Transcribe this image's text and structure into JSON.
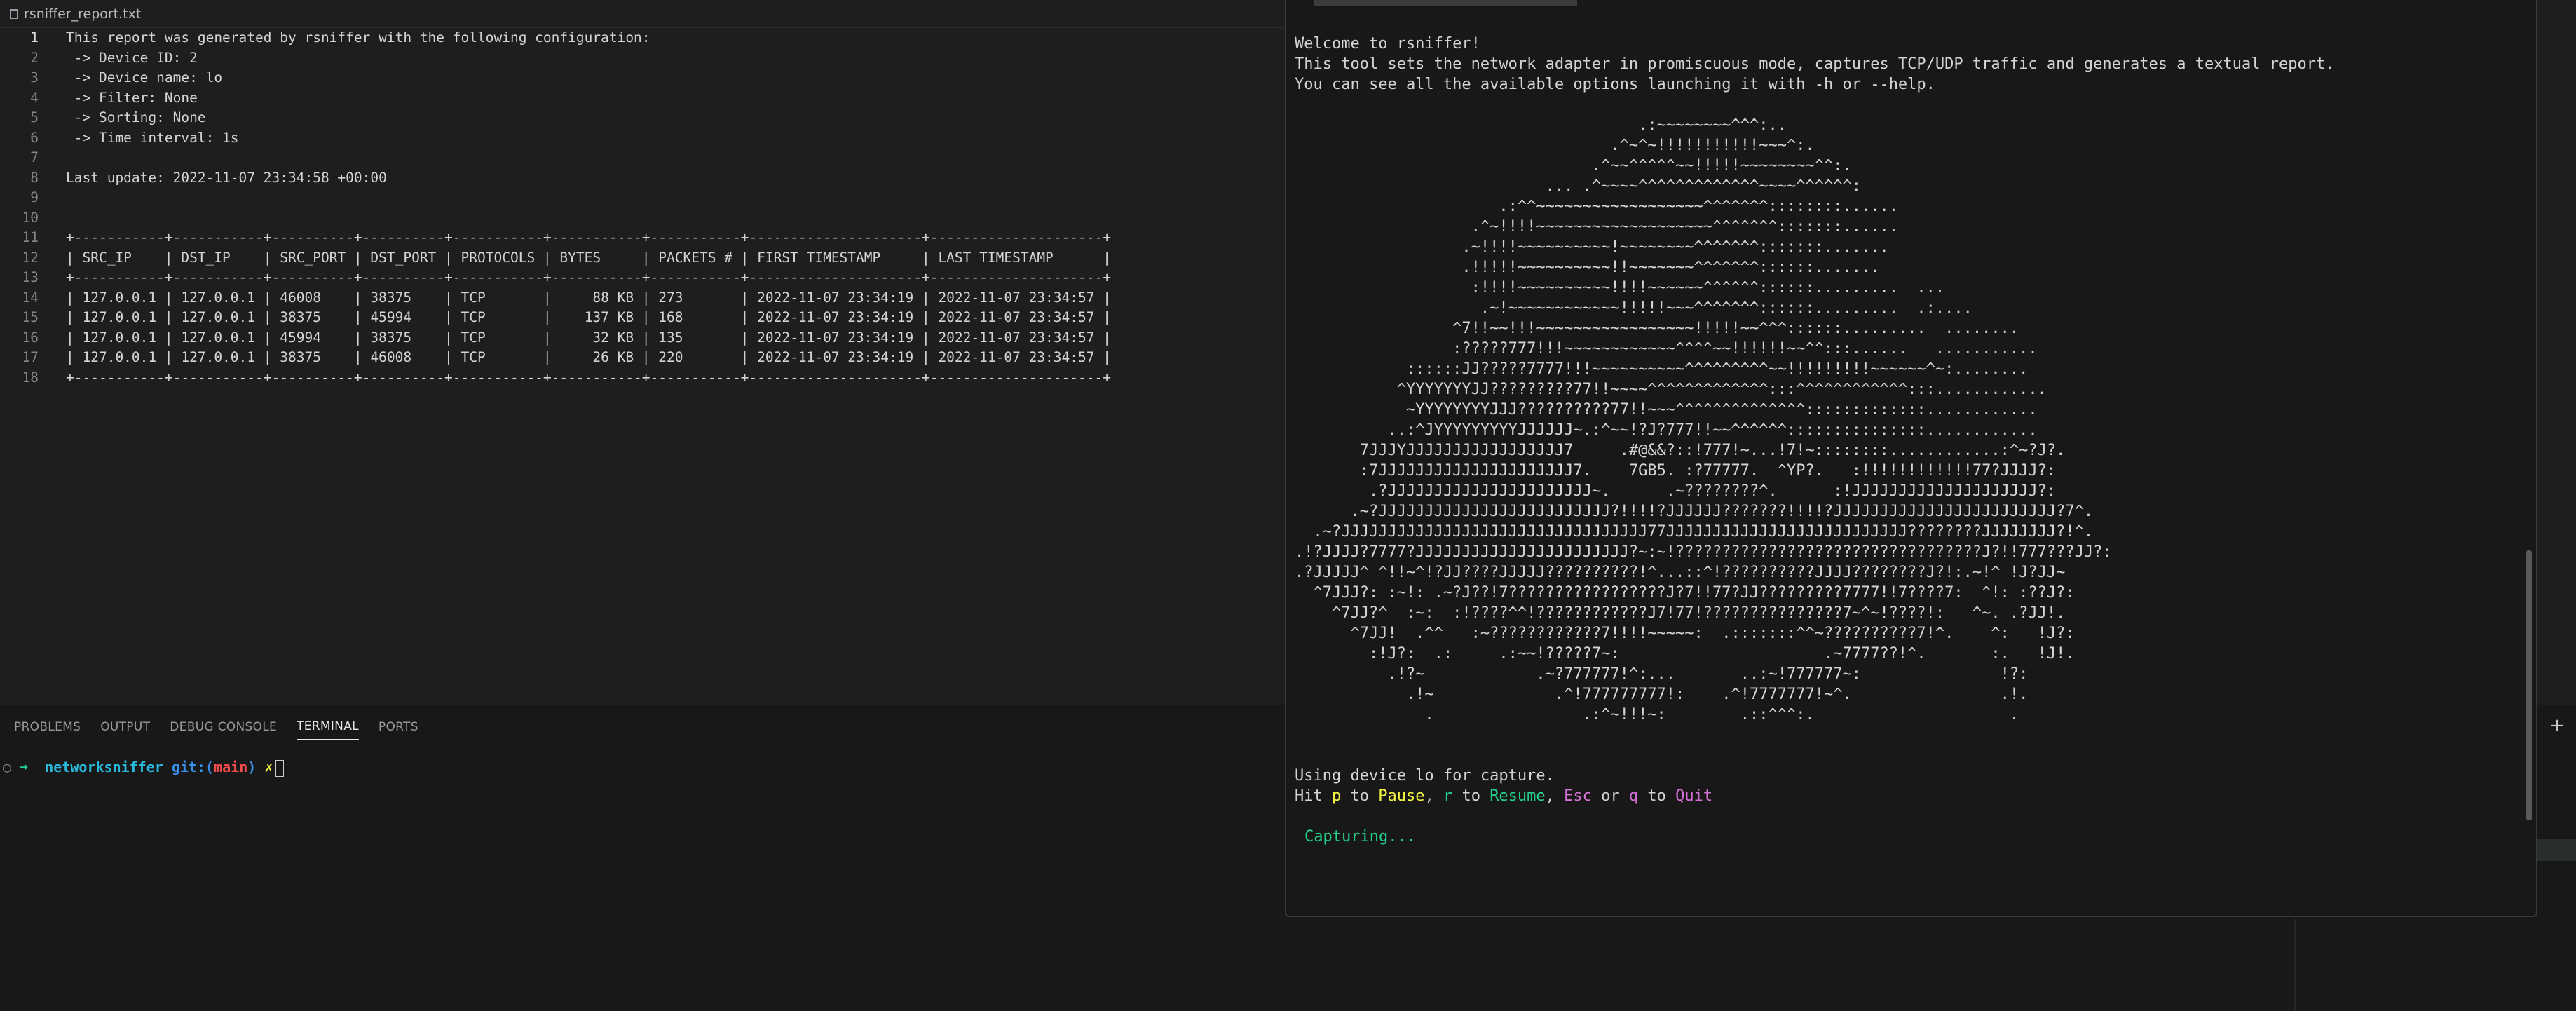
{
  "editor": {
    "tab_title": "rsniffer_report.txt",
    "icon": "file-text-icon",
    "lines": [
      {
        "n": "1",
        "text": "This report was generated by rsniffer with the following configuration:"
      },
      {
        "n": "2",
        "text": " -> Device ID: 2"
      },
      {
        "n": "3",
        "text": " -> Device name: lo"
      },
      {
        "n": "4",
        "text": " -> Filter: None"
      },
      {
        "n": "5",
        "text": " -> Sorting: None"
      },
      {
        "n": "6",
        "text": " -> Time interval: 1s"
      },
      {
        "n": "7",
        "text": ""
      },
      {
        "n": "8",
        "text": "Last update: 2022-11-07 23:34:58 +00:00"
      },
      {
        "n": "9",
        "text": ""
      },
      {
        "n": "10",
        "text": ""
      },
      {
        "n": "11",
        "text": "+-----------+-----------+----------+----------+-----------+-----------+-----------+---------------------+---------------------+"
      },
      {
        "n": "12",
        "text": "| SRC_IP    | DST_IP    | SRC_PORT | DST_PORT | PROTOCOLS | BYTES     | PACKETS # | FIRST TIMESTAMP     | LAST TIMESTAMP      |"
      },
      {
        "n": "13",
        "text": "+-----------+-----------+----------+----------+-----------+-----------+-----------+---------------------+---------------------+"
      },
      {
        "n": "14",
        "text": "| 127.0.0.1 | 127.0.0.1 | 46008    | 38375    | TCP       |     88 KB | 273       | 2022-11-07 23:34:19 | 2022-11-07 23:34:57 |"
      },
      {
        "n": "15",
        "text": "| 127.0.0.1 | 127.0.0.1 | 38375    | 45994    | TCP       |    137 KB | 168       | 2022-11-07 23:34:19 | 2022-11-07 23:34:57 |"
      },
      {
        "n": "16",
        "text": "| 127.0.0.1 | 127.0.0.1 | 45994    | 38375    | TCP       |     32 KB | 135       | 2022-11-07 23:34:19 | 2022-11-07 23:34:57 |"
      },
      {
        "n": "17",
        "text": "| 127.0.0.1 | 127.0.0.1 | 38375    | 46008    | TCP       |     26 KB | 220       | 2022-11-07 23:34:19 | 2022-11-07 23:34:57 |"
      },
      {
        "n": "18",
        "text": "+-----------+-----------+----------+----------+-----------+-----------+-----------+---------------------+---------------------+"
      }
    ]
  },
  "panel": {
    "tabs": [
      "PROBLEMS",
      "OUTPUT",
      "DEBUG CONSOLE",
      "TERMINAL",
      "PORTS"
    ],
    "active_tab": "TERMINAL",
    "prompt": {
      "circle": "○",
      "arrow": "➜",
      "dir": "networksniffer",
      "git_label": "git:(",
      "branch": "main",
      "git_close": ")",
      "dirty_mark": "✗"
    },
    "add_button": "+"
  },
  "terminal": {
    "welcome_1": "Welcome to rsniffer!",
    "welcome_2": "This tool sets the network adapter in promiscuous mode, captures TCP/UDP traffic and generates a textual report.",
    "welcome_3": "You can see all the available options launching it with -h or --help.",
    "ascii_art": [
      "                                     .:~~~~~~~~^^^:..",
      "                                  .^~^~!!!!!!!!!!!~~~^:.",
      "                                .^~~^^^^^~~!!!!!~~~~~~~~^^:.",
      "                           ... .^~~~~^^^^^^^^^^^^^~~~~^^^^^^:",
      "                      .:^^~~~~~~~~~~~~~~~~~~^^^^^^^::::::::......",
      "                   .^~!!!!~~~~~~~~~~~~~~~~~~~^^^^^^^:::::::......",
      "                  .~!!!!~~~~~~~~~~!~~~~~~~~^^^^^^^:::::::.......",
      "                  .!!!!!~~~~~~~~~~!!~~~~~~~^^^^^^^::::::.......",
      "                   :!!!!~~~~~~~~~~!!!!~~~~~~^^^^^^::::::.........  ...",
      "                    .~!~~~~~~~~~~~~!!!!!~~~^^^^^^^::::::.........  .:....",
      "                 ^7!!~~!!!~~~~~~~~~~~~~~~~~!!!!!~~^^^::::::.........  ........",
      "                 :?????777!!!~~~~~~~~~~~~^^^^~~!!!!!!~~^^:::......   ...........",
      "            ::::::JJ?????7777!!!~~~~~~~~~~^^^^^^^^^~~!!!!!!!!!~~~~~~^~:........",
      "           ^YYYYYYYJJ?????????77!!~~~~^^^^^^^^^^^^^:::^^^^^^^^^^^^:::............",
      "            ~YYYYYYYYJJJ??????????77!!~~~^^^^^^^^^^^^^^:::::::::::::............",
      "          ..:^JYYYYYYYYYJJJJJJ~.:^~~!?J?777!!~~^^^^^^:::::::::::::::............",
      "       7JJJYJJJJJJJJJJJJJJJJJ7     .#@&&?::!777!~...!7!~::::::::............:^~?J?.",
      "       :7JJJJJJJJJJJJJJJJJJJJJ7.    7GB5. :?77777.  ^YP?.   :!!!!!!!!!!!!77?JJJJ?:",
      "        .?JJJJJJJJJJJJJJJJJJJJJJ~.      .~????????^.      :!JJJJJJJJJJJJJJJJJJJJ?:",
      "      .~?JJJJJJJJJJJJJJJJJJJJJJJJJ?!!!!?JJJJJJ???????!!!!?JJJJJJJJJJJJJJJJJJJJJJJJ?7^.",
      "  .~?JJJJJJJJJJJJJJJJJJJJJJJJJJJJJJJJJ77JJJJJJJJJJJJJJJJJJJJJJJJJJ????????JJJJJJJJ?!^.",
      ".!?JJJJ?7777?JJJJJJJJJJJJJJJJJJJJJJJ?~:~!?????????????????????????????????J?!!777???JJ?:",
      ".?JJJJJ^ ^!!~^!?JJ????JJJJJ??????????!^...::^!??????????JJJJ????????J?!:.~!^ !J?JJ~",
      "  ^7JJJ?: :~!: .~?J??!7?????????????????J?7!!77?JJ?????????7777!!7????7:  ^!: :??J?:",
      "    ^7JJ?^  :~:  :!????^^!????????????J7!77!???????????????7~^~!????!:   ^~. .?JJ!.",
      "      ^7JJ!  .^^   :~????????????7!!!!~~~~~:  .:::::::^^~??????????7!^.    ^:   !J?:",
      "        :!J?:  .:     .:~~!?????7~:                      .~7777??!^.       :.   !J!.",
      "          .!?~            .~?777777!^:...       ..:~!777777~:               !?:",
      "            .!~             .^!777777777!:    .^!7777777!~^.                .!.",
      "              .                .:^~!!!~:        .::^^^:.                     ."
    ],
    "device_line_1": "Using device lo for capture.",
    "hit_1": "Hit ",
    "key_p": "p",
    "to_1": " to ",
    "pause": "Pause",
    "comma_1": ", ",
    "key_r": "r",
    "to_2": " to ",
    "resume": "Resume",
    "comma_2": ", ",
    "key_esc": "Esc",
    "or": " or ",
    "key_q": "q",
    "to_3": " to ",
    "quit": "Quit",
    "status": "Capturing..."
  }
}
